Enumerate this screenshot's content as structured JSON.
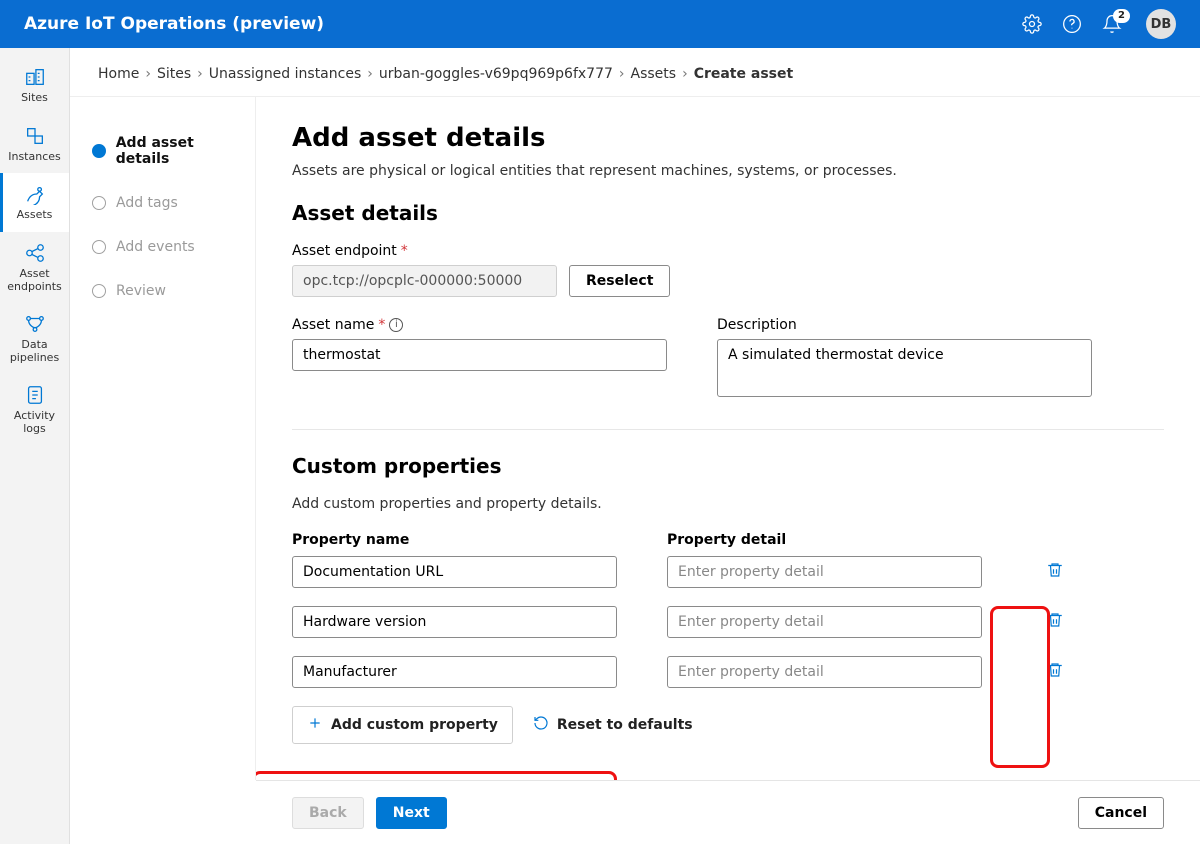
{
  "header": {
    "title": "Azure IoT Operations (preview)",
    "notif_count": "2",
    "avatar_initials": "DB"
  },
  "leftnav": {
    "items": [
      {
        "label": "Sites",
        "id": "sites"
      },
      {
        "label": "Instances",
        "id": "instances"
      },
      {
        "label": "Assets",
        "id": "assets",
        "active": true
      },
      {
        "label": "Asset endpoints",
        "id": "asset-endpoints"
      },
      {
        "label": "Data pipelines",
        "id": "data-pipelines"
      },
      {
        "label": "Activity logs",
        "id": "activity-logs"
      }
    ]
  },
  "breadcrumb": {
    "parts": [
      "Home",
      "Sites",
      "Unassigned instances",
      "urban-goggles-v69pq969p6fx777",
      "Assets"
    ],
    "current": "Create asset"
  },
  "wizard": {
    "steps": [
      {
        "label": "Add asset details",
        "current": true
      },
      {
        "label": "Add tags"
      },
      {
        "label": "Add events"
      },
      {
        "label": "Review"
      }
    ]
  },
  "page": {
    "title": "Add asset details",
    "subtitle": "Assets are physical or logical entities that represent machines, systems, or processes.",
    "section_asset_details": "Asset details",
    "endpoint_label": "Asset endpoint",
    "endpoint_value": "opc.tcp://opcplc-000000:50000",
    "reselect_label": "Reselect",
    "asset_name_label": "Asset name",
    "asset_name_value": "thermostat",
    "description_label": "Description",
    "description_value": "A simulated thermostat device",
    "section_custom_props": "Custom properties",
    "custom_props_subtitle": "Add custom properties and property details.",
    "col_prop_name": "Property name",
    "col_prop_detail": "Property detail",
    "prop_detail_placeholder": "Enter property detail",
    "props": [
      {
        "name": "Documentation URL",
        "detail": ""
      },
      {
        "name": "Hardware version",
        "detail": ""
      },
      {
        "name": "Manufacturer",
        "detail": ""
      }
    ],
    "add_custom_label": "Add custom property",
    "reset_defaults_label": "Reset to defaults"
  },
  "footer": {
    "back": "Back",
    "next": "Next",
    "cancel": "Cancel"
  }
}
